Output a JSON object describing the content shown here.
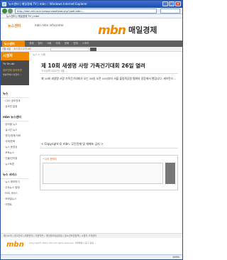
{
  "window": {
    "title": "뉴스센터 | 매일경제 TV | mbn :: Windows Internet Explorer"
  },
  "browser": {
    "url": "http://mbn.mk.co.kr/news/newsRead.php?vodCode=...",
    "tab_title": "뉴스센터 | 매일경제 TV | mbn",
    "status": "",
    "zoom": "100%"
  },
  "header": {
    "small_logo": "뉴스센터",
    "top_links": "mbn  mbn infocenter",
    "brand": "mbn",
    "brand_korean": "매일경제"
  },
  "nav": {
    "selected": "뉴스센터",
    "items": [
      "경제",
      "정치",
      "사회",
      "국제",
      "문화",
      "연예",
      "스포츠"
    ]
  },
  "datebar": {
    "date": "3월 8일",
    "index": "코스피 1175.62"
  },
  "sidebar": {
    "top": "시청자",
    "promo_title": "TV On Air",
    "promo_text": "공모전에 참여하면",
    "promo_text2": "방송국에서 상금이 ...",
    "section1": "뉴스",
    "section1_items": [
      "CEO 공모전과",
      "공모전 일정"
    ],
    "section2": "mbn 뉴스센터",
    "section2_items": [
      "분야별 뉴스",
      "실시간 뉴스",
      "정치/경제/사회",
      "국제/문화",
      "뉴스 동영상",
      "포토뉴스",
      "인물/인터뷰",
      "뉴스토론"
    ],
    "section3": "뉴스 서비스",
    "section3_items": [
      "뉴스 제보하기",
      "주요뉴스 알림",
      "RSS 서비스",
      "모바일뉴스",
      "이벤트"
    ]
  },
  "article": {
    "breadcrumb": "뉴스 > 사회",
    "title": "제 10회 새생명 사랑 가족건기대회 26일 열려",
    "meta": "기사입력 2007년 3월 ...",
    "body": "제 10회 새생명 사랑 가족건기대회가 오는 26일 오전 10시부터 서울 올림픽공원 평화의 광장에서 열립니다. 세브란스...",
    "copyright": "< Copyright © mbn. 무단전재 및 재배포 금지 >"
  },
  "reply": {
    "label": "• 나도 한마디"
  },
  "footer": {
    "links": "회사소개 | 광고안내 | 제휴문의 | 이용약관 | 개인정보취급방침 | 청소년보호정책 | 시청자 고객센터",
    "brand": "mbn",
    "text": "Copyright© 2007 mbn All rights reserved. 서울특별시 중구 필동 ..."
  }
}
